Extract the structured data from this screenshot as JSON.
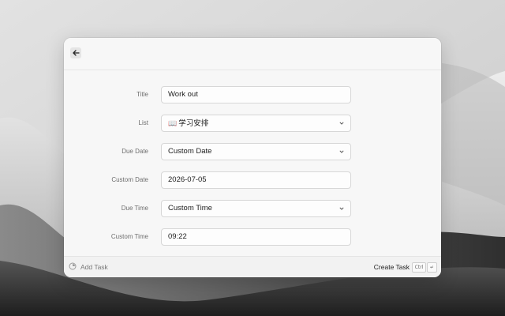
{
  "window": {
    "back_icon": "arrow-left-icon"
  },
  "form": {
    "title": {
      "label": "Title",
      "value": "Work out"
    },
    "list": {
      "label": "List",
      "icon": "open-book-emoji",
      "value": "学习安排"
    },
    "due_date": {
      "label": "Due Date",
      "value": "Custom Date"
    },
    "custom_date": {
      "label": "Custom Date",
      "value": "2026-07-05"
    },
    "due_time": {
      "label": "Due Time",
      "value": "Custom Time"
    },
    "custom_time": {
      "label": "Custom Time",
      "value": "09:22"
    }
  },
  "footer": {
    "add_task_icon": "task-spinner-icon",
    "add_task_label": "Add Task",
    "create_task_label": "Create Task",
    "shortcut_ctrl": "Ctrl",
    "shortcut_enter": "↵"
  },
  "colors": {
    "window_bg": "#f7f7f7",
    "field_border": "#d7d7d7",
    "label_text": "#6e6e6e"
  }
}
